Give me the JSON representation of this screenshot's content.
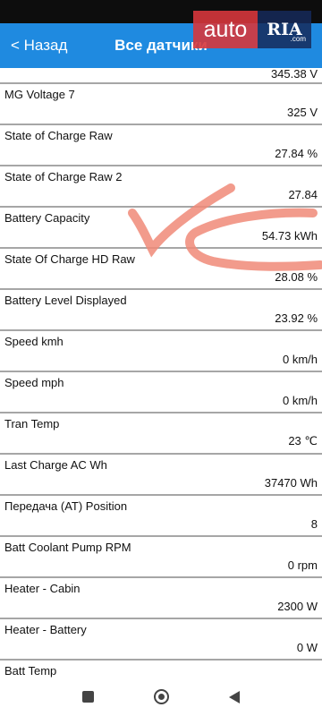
{
  "header": {
    "back_label": "< Назад",
    "title": "Все датчики"
  },
  "watermark": {
    "auto": "auto",
    "ria": "RIA",
    "com": ".com"
  },
  "rows": [
    {
      "label": "",
      "value": "345.38 V"
    },
    {
      "label": "MG Voltage 7",
      "value": "325 V"
    },
    {
      "label": "State of Charge Raw",
      "value": "27.84 %"
    },
    {
      "label": "State of Charge Raw 2",
      "value": "27.84"
    },
    {
      "label": "Battery Capacity",
      "value": "54.73 kWh"
    },
    {
      "label": "State Of Charge HD Raw",
      "value": "28.08 %"
    },
    {
      "label": "Battery Level Displayed",
      "value": "23.92 %"
    },
    {
      "label": "Speed kmh",
      "value": "0 km/h"
    },
    {
      "label": "Speed mph",
      "value": "0 km/h"
    },
    {
      "label": "Tran Temp",
      "value": "23 ℃"
    },
    {
      "label": "Last Charge AC Wh",
      "value": "37470 Wh"
    },
    {
      "label": "Передача (AT) Position",
      "value": "8"
    },
    {
      "label": "Batt Coolant Pump RPM",
      "value": "0 rpm"
    },
    {
      "label": "Heater - Cabin",
      "value": "2300 W"
    },
    {
      "label": "Heater - Battery",
      "value": "0 W"
    },
    {
      "label": "Batt Temp",
      "value": ""
    }
  ],
  "colors": {
    "app_bar": "#1f8ae0",
    "annotation": "#f08a78"
  }
}
